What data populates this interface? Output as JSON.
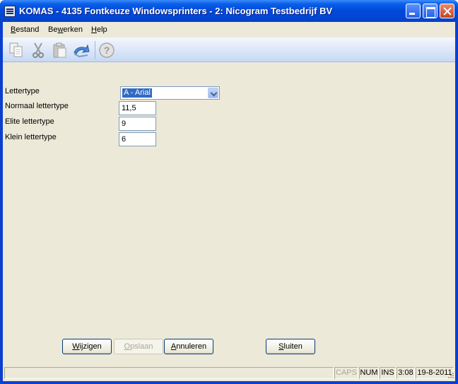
{
  "window": {
    "title": "KOMAS - 4135 Fontkeuze Windowsprinters - 2: Nicogram Testbedrijf BV"
  },
  "menu": {
    "items": [
      {
        "label": "Bestand",
        "mnemonic": "B"
      },
      {
        "label": "Bewerken",
        "mnemonic": "w"
      },
      {
        "label": "Help",
        "mnemonic": "H"
      }
    ]
  },
  "toolbar": {
    "icons": [
      "copy-icon",
      "cut-icon",
      "paste-icon",
      "undo-icon",
      "help-icon"
    ]
  },
  "form": {
    "lettertype": {
      "label": "Lettertype",
      "value": "A - Arial"
    },
    "normaal": {
      "label": "Normaal lettertype",
      "value": "11,5"
    },
    "elite": {
      "label": "Elite lettertype",
      "value": "9"
    },
    "klein": {
      "label": "Klein lettertype",
      "value": "6"
    }
  },
  "buttons": {
    "wijzigen": {
      "label": "Wijzigen",
      "mnemonic": "W"
    },
    "opslaan": {
      "label": "Opslaan",
      "mnemonic": "O",
      "enabled": false
    },
    "annuleren": {
      "label": "Annuleren",
      "mnemonic": "A"
    },
    "sluiten": {
      "label": "Sluiten",
      "mnemonic": "S"
    }
  },
  "status": {
    "caps": "CAPS",
    "num": "NUM",
    "ins": "INS",
    "time": "3:08",
    "date": "19-8-2011"
  }
}
